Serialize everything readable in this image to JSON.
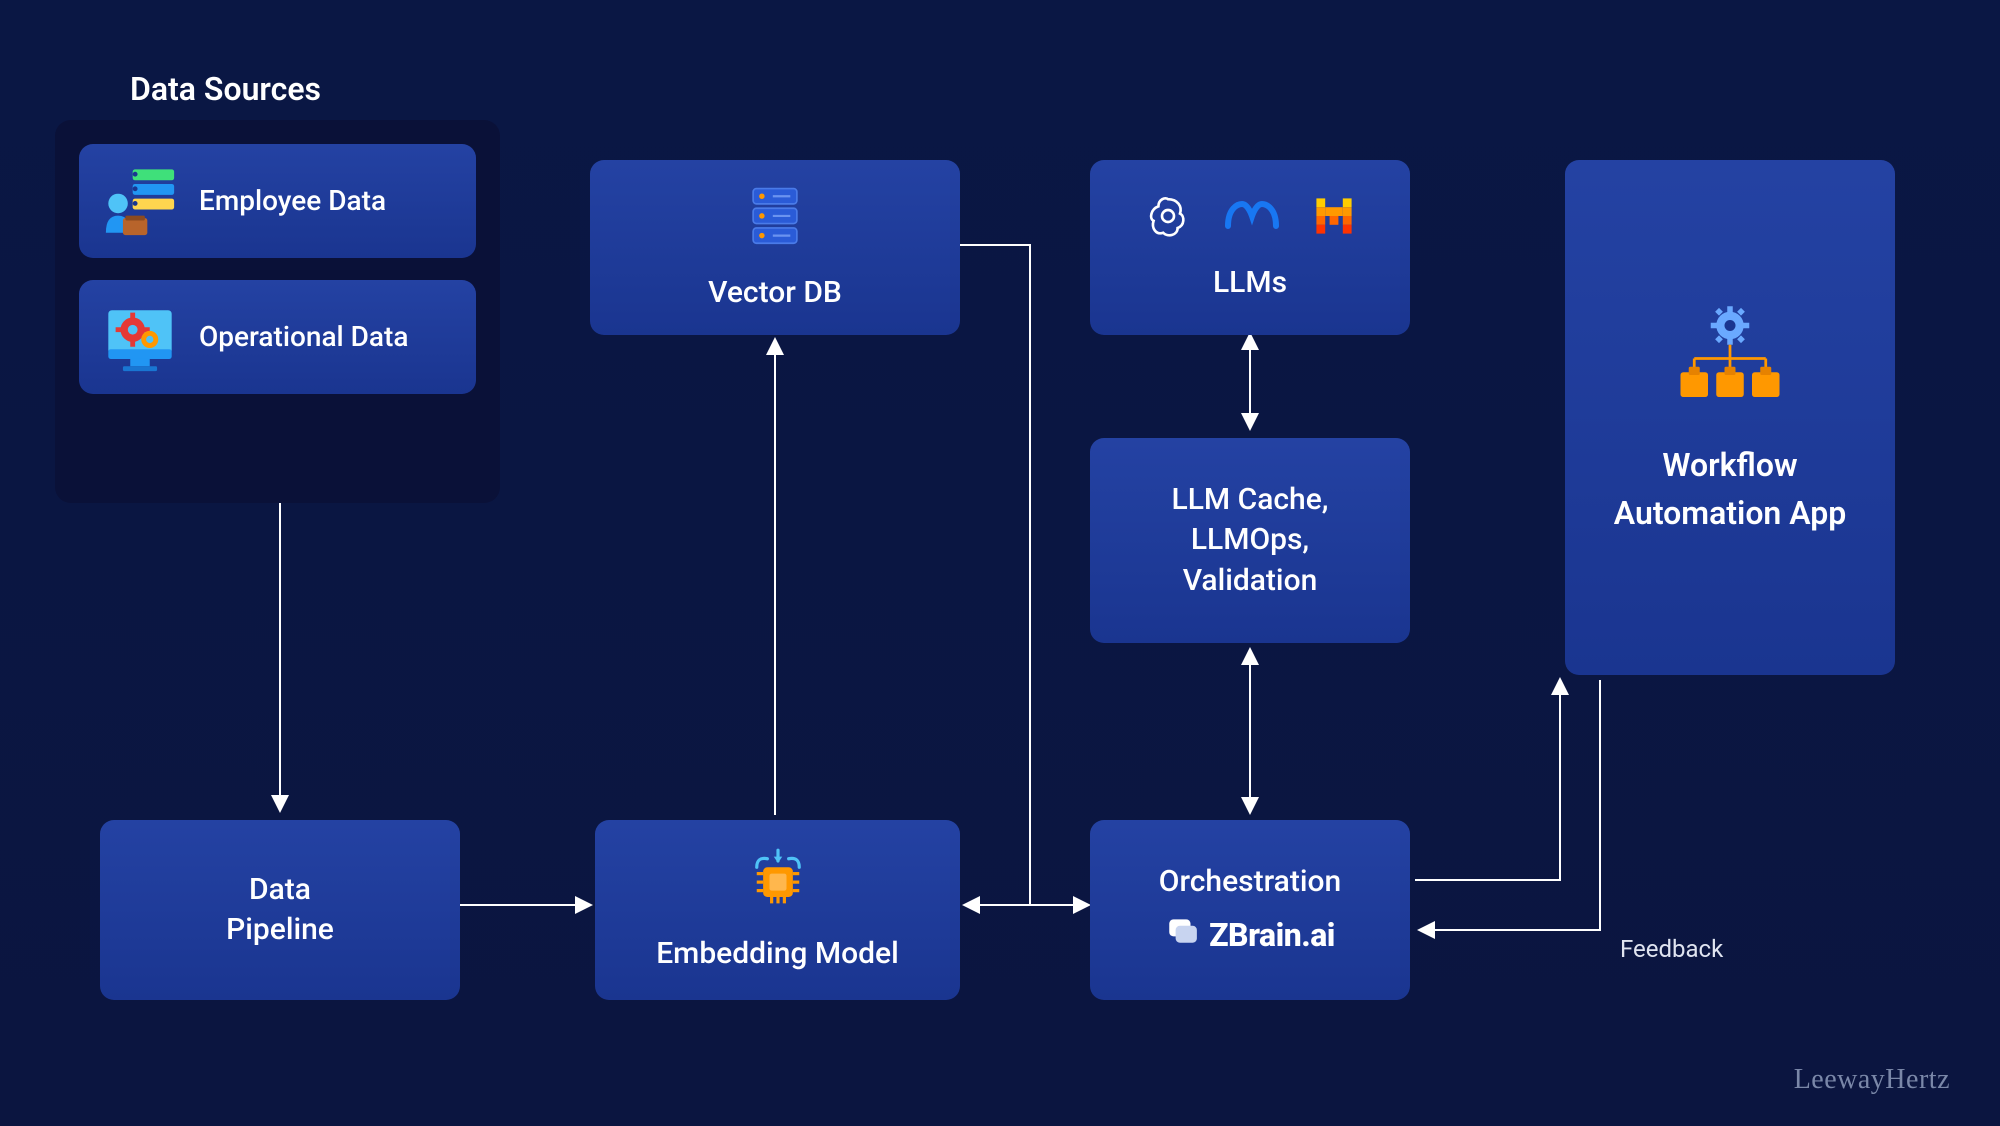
{
  "title": "Data Sources",
  "sources": {
    "employee": "Employee Data",
    "operational": "Operational Data"
  },
  "nodes": {
    "data_pipeline": "Data\nPipeline",
    "vector_db": "Vector DB",
    "embedding_model": "Embedding Model",
    "llms": "LLMs",
    "llm_cache": "LLM Cache,\nLLMOps,\nValidation",
    "orchestration": "Orchestration",
    "orchestration_brand": "ZBrain.ai",
    "workflow_app": "Workflow Automation App"
  },
  "labels": {
    "feedback": "Feedback"
  },
  "watermark": "LeewayHertz"
}
